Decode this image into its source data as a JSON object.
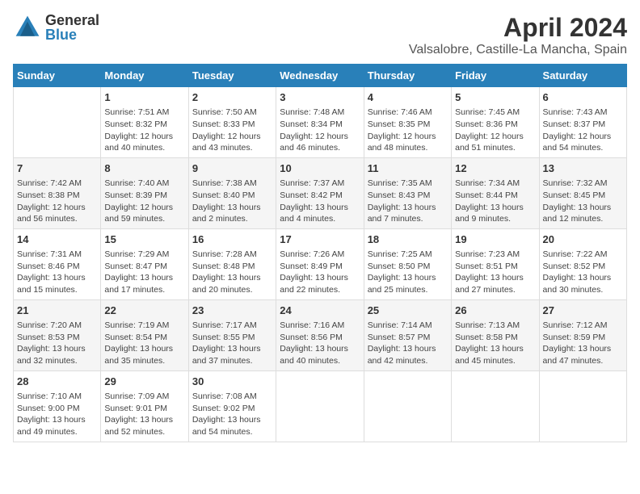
{
  "header": {
    "logo_line1": "General",
    "logo_line2": "Blue",
    "title": "April 2024",
    "subtitle": "Valsalobre, Castille-La Mancha, Spain"
  },
  "days_of_week": [
    "Sunday",
    "Monday",
    "Tuesday",
    "Wednesday",
    "Thursday",
    "Friday",
    "Saturday"
  ],
  "weeks": [
    [
      {
        "day": "",
        "sunrise": "",
        "sunset": "",
        "daylight": ""
      },
      {
        "day": "1",
        "sunrise": "Sunrise: 7:51 AM",
        "sunset": "Sunset: 8:32 PM",
        "daylight": "Daylight: 12 hours and 40 minutes."
      },
      {
        "day": "2",
        "sunrise": "Sunrise: 7:50 AM",
        "sunset": "Sunset: 8:33 PM",
        "daylight": "Daylight: 12 hours and 43 minutes."
      },
      {
        "day": "3",
        "sunrise": "Sunrise: 7:48 AM",
        "sunset": "Sunset: 8:34 PM",
        "daylight": "Daylight: 12 hours and 46 minutes."
      },
      {
        "day": "4",
        "sunrise": "Sunrise: 7:46 AM",
        "sunset": "Sunset: 8:35 PM",
        "daylight": "Daylight: 12 hours and 48 minutes."
      },
      {
        "day": "5",
        "sunrise": "Sunrise: 7:45 AM",
        "sunset": "Sunset: 8:36 PM",
        "daylight": "Daylight: 12 hours and 51 minutes."
      },
      {
        "day": "6",
        "sunrise": "Sunrise: 7:43 AM",
        "sunset": "Sunset: 8:37 PM",
        "daylight": "Daylight: 12 hours and 54 minutes."
      }
    ],
    [
      {
        "day": "7",
        "sunrise": "Sunrise: 7:42 AM",
        "sunset": "Sunset: 8:38 PM",
        "daylight": "Daylight: 12 hours and 56 minutes."
      },
      {
        "day": "8",
        "sunrise": "Sunrise: 7:40 AM",
        "sunset": "Sunset: 8:39 PM",
        "daylight": "Daylight: 12 hours and 59 minutes."
      },
      {
        "day": "9",
        "sunrise": "Sunrise: 7:38 AM",
        "sunset": "Sunset: 8:40 PM",
        "daylight": "Daylight: 13 hours and 2 minutes."
      },
      {
        "day": "10",
        "sunrise": "Sunrise: 7:37 AM",
        "sunset": "Sunset: 8:42 PM",
        "daylight": "Daylight: 13 hours and 4 minutes."
      },
      {
        "day": "11",
        "sunrise": "Sunrise: 7:35 AM",
        "sunset": "Sunset: 8:43 PM",
        "daylight": "Daylight: 13 hours and 7 minutes."
      },
      {
        "day": "12",
        "sunrise": "Sunrise: 7:34 AM",
        "sunset": "Sunset: 8:44 PM",
        "daylight": "Daylight: 13 hours and 9 minutes."
      },
      {
        "day": "13",
        "sunrise": "Sunrise: 7:32 AM",
        "sunset": "Sunset: 8:45 PM",
        "daylight": "Daylight: 13 hours and 12 minutes."
      }
    ],
    [
      {
        "day": "14",
        "sunrise": "Sunrise: 7:31 AM",
        "sunset": "Sunset: 8:46 PM",
        "daylight": "Daylight: 13 hours and 15 minutes."
      },
      {
        "day": "15",
        "sunrise": "Sunrise: 7:29 AM",
        "sunset": "Sunset: 8:47 PM",
        "daylight": "Daylight: 13 hours and 17 minutes."
      },
      {
        "day": "16",
        "sunrise": "Sunrise: 7:28 AM",
        "sunset": "Sunset: 8:48 PM",
        "daylight": "Daylight: 13 hours and 20 minutes."
      },
      {
        "day": "17",
        "sunrise": "Sunrise: 7:26 AM",
        "sunset": "Sunset: 8:49 PM",
        "daylight": "Daylight: 13 hours and 22 minutes."
      },
      {
        "day": "18",
        "sunrise": "Sunrise: 7:25 AM",
        "sunset": "Sunset: 8:50 PM",
        "daylight": "Daylight: 13 hours and 25 minutes."
      },
      {
        "day": "19",
        "sunrise": "Sunrise: 7:23 AM",
        "sunset": "Sunset: 8:51 PM",
        "daylight": "Daylight: 13 hours and 27 minutes."
      },
      {
        "day": "20",
        "sunrise": "Sunrise: 7:22 AM",
        "sunset": "Sunset: 8:52 PM",
        "daylight": "Daylight: 13 hours and 30 minutes."
      }
    ],
    [
      {
        "day": "21",
        "sunrise": "Sunrise: 7:20 AM",
        "sunset": "Sunset: 8:53 PM",
        "daylight": "Daylight: 13 hours and 32 minutes."
      },
      {
        "day": "22",
        "sunrise": "Sunrise: 7:19 AM",
        "sunset": "Sunset: 8:54 PM",
        "daylight": "Daylight: 13 hours and 35 minutes."
      },
      {
        "day": "23",
        "sunrise": "Sunrise: 7:17 AM",
        "sunset": "Sunset: 8:55 PM",
        "daylight": "Daylight: 13 hours and 37 minutes."
      },
      {
        "day": "24",
        "sunrise": "Sunrise: 7:16 AM",
        "sunset": "Sunset: 8:56 PM",
        "daylight": "Daylight: 13 hours and 40 minutes."
      },
      {
        "day": "25",
        "sunrise": "Sunrise: 7:14 AM",
        "sunset": "Sunset: 8:57 PM",
        "daylight": "Daylight: 13 hours and 42 minutes."
      },
      {
        "day": "26",
        "sunrise": "Sunrise: 7:13 AM",
        "sunset": "Sunset: 8:58 PM",
        "daylight": "Daylight: 13 hours and 45 minutes."
      },
      {
        "day": "27",
        "sunrise": "Sunrise: 7:12 AM",
        "sunset": "Sunset: 8:59 PM",
        "daylight": "Daylight: 13 hours and 47 minutes."
      }
    ],
    [
      {
        "day": "28",
        "sunrise": "Sunrise: 7:10 AM",
        "sunset": "Sunset: 9:00 PM",
        "daylight": "Daylight: 13 hours and 49 minutes."
      },
      {
        "day": "29",
        "sunrise": "Sunrise: 7:09 AM",
        "sunset": "Sunset: 9:01 PM",
        "daylight": "Daylight: 13 hours and 52 minutes."
      },
      {
        "day": "30",
        "sunrise": "Sunrise: 7:08 AM",
        "sunset": "Sunset: 9:02 PM",
        "daylight": "Daylight: 13 hours and 54 minutes."
      },
      {
        "day": "",
        "sunrise": "",
        "sunset": "",
        "daylight": ""
      },
      {
        "day": "",
        "sunrise": "",
        "sunset": "",
        "daylight": ""
      },
      {
        "day": "",
        "sunrise": "",
        "sunset": "",
        "daylight": ""
      },
      {
        "day": "",
        "sunrise": "",
        "sunset": "",
        "daylight": ""
      }
    ]
  ]
}
